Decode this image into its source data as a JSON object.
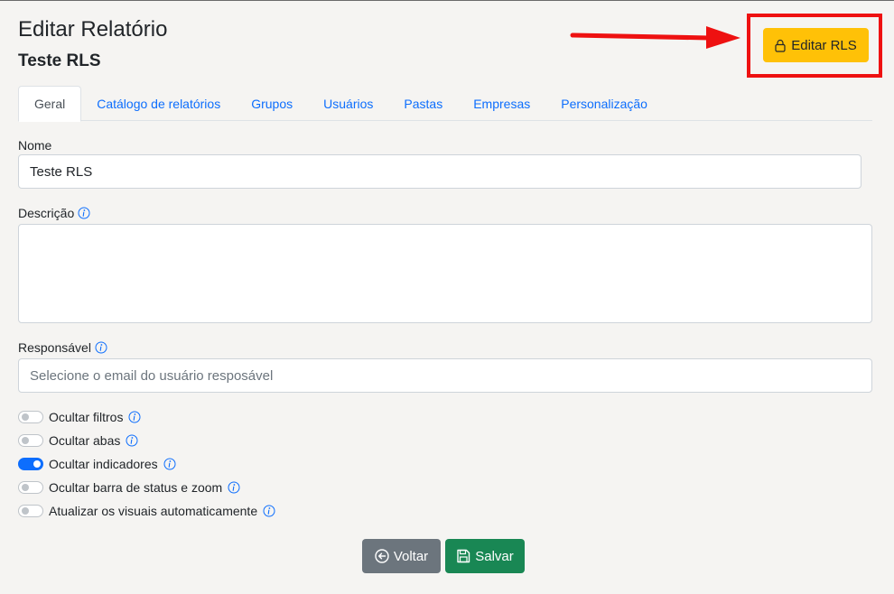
{
  "header": {
    "title": "Editar Relatório",
    "report_name": "Teste RLS",
    "rls_button_label": "Editar RLS"
  },
  "tabs": [
    {
      "label": "Geral",
      "active": true
    },
    {
      "label": "Catálogo de relatórios",
      "active": false
    },
    {
      "label": "Grupos",
      "active": false
    },
    {
      "label": "Usuários",
      "active": false
    },
    {
      "label": "Pastas",
      "active": false
    },
    {
      "label": "Empresas",
      "active": false
    },
    {
      "label": "Personalização",
      "active": false
    }
  ],
  "form": {
    "name_label": "Nome",
    "name_value": "Teste RLS",
    "description_label": "Descrição",
    "description_value": "",
    "owner_label": "Responsável",
    "owner_placeholder": "Selecione o email do usuário resposável"
  },
  "toggles": [
    {
      "label": "Ocultar filtros",
      "on": false
    },
    {
      "label": "Ocultar abas",
      "on": false
    },
    {
      "label": "Ocultar indicadores",
      "on": true
    },
    {
      "label": "Ocultar barra de status e zoom",
      "on": false
    },
    {
      "label": "Atualizar os visuais automaticamente",
      "on": false
    }
  ],
  "actions": {
    "back_label": "Voltar",
    "save_label": "Salvar"
  },
  "colors": {
    "accent": "#0d6efd",
    "warning": "#ffc107",
    "success": "#198754",
    "secondary": "#6c757d",
    "annotation": "#ee1111"
  },
  "icons": {
    "rls": "lock-icon",
    "info": "info-icon",
    "back": "arrow-left-circle-icon",
    "save": "floppy-disk-icon"
  }
}
